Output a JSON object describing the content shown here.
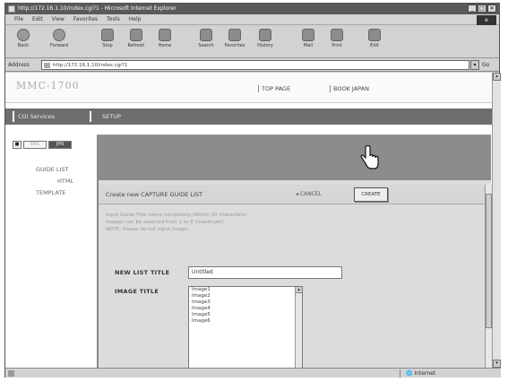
{
  "window": {
    "title": "http://172.16.1.10/index.cgi?1 - Microsoft Internet Explorer",
    "controls": [
      "_",
      "□",
      "✕"
    ]
  },
  "menu": [
    "File",
    "Edit",
    "View",
    "Favorites",
    "Tools",
    "Help"
  ],
  "toolbar": {
    "back": "Back",
    "forward": "Forward",
    "stop": "Stop",
    "refresh": "Refresh",
    "home": "Home",
    "search": "Search",
    "favorites": "Favorites",
    "history": "History",
    "mail": "Mail",
    "print": "Print",
    "edit": "Edit"
  },
  "address": {
    "label": "Address",
    "url": "http://172.16.1.10/index.cgi?1",
    "go": "Go"
  },
  "site": {
    "logo": "MMC-1700",
    "links": [
      "TOP PAGE",
      "BOOK JAPAN"
    ],
    "nav": {
      "active_tab": "CGI Services",
      "setup_tab": "SETUP"
    },
    "lang": [
      "■",
      "ENG",
      "JPN"
    ],
    "sidebar": [
      "GUIDE LIST",
      "HTML",
      "TEMPLATE"
    ]
  },
  "form": {
    "heading": "Create new CAPTURE GUIDE LIST",
    "cancel_label": "CANCEL",
    "create_label": "CREATE",
    "notes": [
      "Input Guide Title name completely.(Within 30 characters)",
      "Images can be selected from 1 to 8 (maximum).",
      "NOTE: Please do not input Image."
    ],
    "new_list_title_label": "NEW LIST TITLE",
    "new_list_title_value": "Untitled",
    "image_title_label": "IMAGE TITLE",
    "image_options": [
      "Image1",
      "Image2",
      "Image3",
      "Image4",
      "Image5",
      "Image6"
    ]
  },
  "status": {
    "zone": "Internet"
  }
}
